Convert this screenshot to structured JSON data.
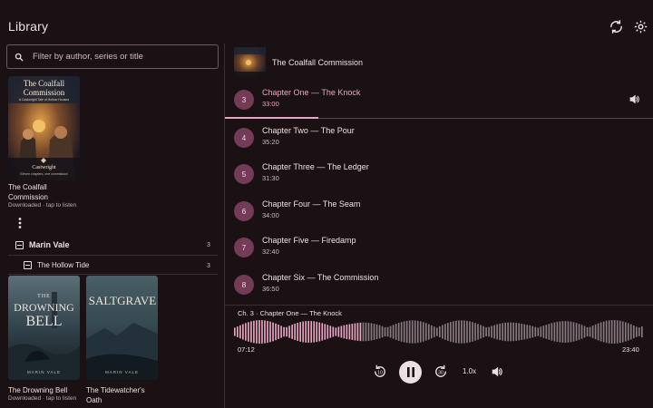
{
  "app": {
    "title": "Library",
    "sync_icon": "sync-icon",
    "settings_icon": "gear-icon"
  },
  "filter": {
    "placeholder": "Filter by author, series or title",
    "value": ""
  },
  "standalone_book": {
    "cover_title": "The Coalfall Commission",
    "cover_subtitle": "A Castwright Tale of Hollow Houses",
    "cover_author": "Castwright",
    "cover_tagline": "Eleven chapters, one commission",
    "title_line1": "The Coalfall",
    "title_line2": "Commission",
    "status": "Downloaded · tap to listen"
  },
  "author_group": {
    "name": "Marin Vale",
    "count": "3"
  },
  "series_group": {
    "name": "The Hollow Tide",
    "count": "3"
  },
  "series_books": [
    {
      "cover_title_top": "THE",
      "cover_title_mid": "DROWNING",
      "cover_title_bottom": "BELL",
      "cover_author": "MARIN VALE",
      "title": "The Drowning Bell",
      "status": "Downloaded · tap to listen"
    },
    {
      "cover_title_mid": "SALTGRAVE",
      "cover_author": "MARIN VALE",
      "title_line1": "The Tidewatcher's",
      "title_line2": "Oath",
      "status": ""
    }
  ],
  "player": {
    "book_title": "The Coalfall Commission",
    "chapters": [
      {
        "num": "3",
        "title": "Chapter One — The Knock",
        "duration": "33:00",
        "active": true,
        "progress": 0.22
      },
      {
        "num": "4",
        "title": "Chapter Two — The Pour",
        "duration": "35:20"
      },
      {
        "num": "5",
        "title": "Chapter Three — The Ledger",
        "duration": "31:30"
      },
      {
        "num": "6",
        "title": "Chapter Four — The Seam",
        "duration": "34:00"
      },
      {
        "num": "7",
        "title": "Chapter Five — Firedamp",
        "duration": "32:40"
      },
      {
        "num": "8",
        "title": "Chapter Six — The Commission",
        "duration": "36:50"
      }
    ],
    "now_playing_label": "Ch. 3 · Chapter One — The Knock",
    "elapsed": "07:12",
    "total": "23:40",
    "progress": 0.31,
    "speed": "1.0x",
    "colors": {
      "accent": "#e9a6c3",
      "chapter_badge": "#733b55",
      "waveform_unplayed": "#8a7a82"
    }
  }
}
